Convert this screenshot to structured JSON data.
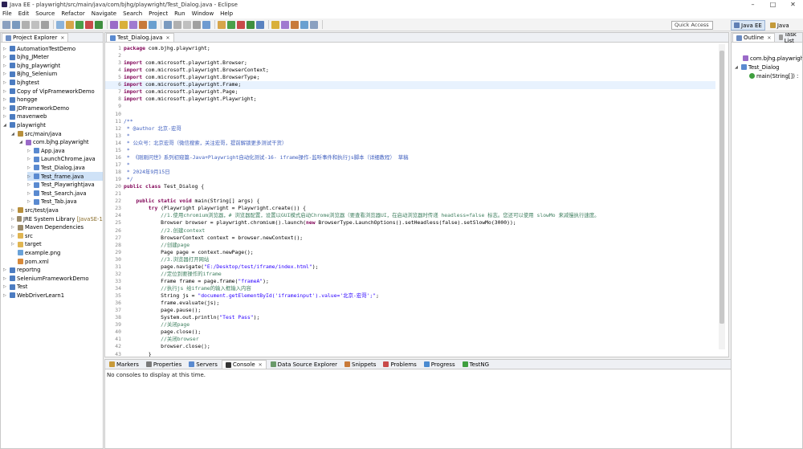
{
  "window": {
    "title": "Java EE - playwright/src/main/java/com/bjhg/playwright/Test_Dialog.java - Eclipse"
  },
  "menu": [
    "File",
    "Edit",
    "Source",
    "Refactor",
    "Navigate",
    "Search",
    "Project",
    "Run",
    "Window",
    "Help"
  ],
  "quick_access": {
    "label": "Quick Access"
  },
  "perspectives": [
    "Java EE",
    "Java"
  ],
  "project_explorer": {
    "tab_label": "Project Explorer",
    "items": [
      {
        "label": "AutomationTestDemo",
        "level": 0,
        "icon": "project",
        "twisty": "closed"
      },
      {
        "label": "bjhg_JMeter",
        "level": 0,
        "icon": "project",
        "twisty": "closed"
      },
      {
        "label": "bjhg_playwright",
        "level": 0,
        "icon": "project",
        "twisty": "closed"
      },
      {
        "label": "Bjhg_Selenium",
        "level": 0,
        "icon": "project",
        "twisty": "closed"
      },
      {
        "label": "bjhgtest",
        "level": 0,
        "icon": "project",
        "twisty": "closed"
      },
      {
        "label": "Copy of VipFrameworkDemo",
        "level": 0,
        "icon": "project",
        "twisty": "closed"
      },
      {
        "label": "hongge",
        "level": 0,
        "icon": "project",
        "twisty": "closed"
      },
      {
        "label": "JDFrameworkDemo",
        "level": 0,
        "icon": "project",
        "twisty": "closed"
      },
      {
        "label": "mavenweb",
        "level": 0,
        "icon": "project",
        "twisty": "closed"
      },
      {
        "label": "playwright",
        "level": 0,
        "icon": "project",
        "twisty": "open"
      },
      {
        "label": "src/main/java",
        "level": 1,
        "icon": "src",
        "twisty": "open"
      },
      {
        "label": "com.bjhg.playwright",
        "level": 2,
        "icon": "pkg",
        "twisty": "open"
      },
      {
        "label": "App.java",
        "level": 3,
        "icon": "java",
        "twisty": "closed"
      },
      {
        "label": "LaunchChrome.java",
        "level": 3,
        "icon": "java",
        "twisty": "closed"
      },
      {
        "label": "Test_Dialog.java",
        "level": 3,
        "icon": "java",
        "twisty": "closed"
      },
      {
        "label": "Test_frame.java",
        "level": 3,
        "icon": "java",
        "twisty": "closed",
        "selected": true
      },
      {
        "label": "Test_Playwrightjava",
        "level": 3,
        "icon": "java",
        "twisty": "closed"
      },
      {
        "label": "Test_Search.java",
        "level": 3,
        "icon": "java",
        "twisty": "closed"
      },
      {
        "label": "Test_Tab.java",
        "level": 3,
        "icon": "java",
        "twisty": "closed"
      },
      {
        "label": "src/test/java",
        "level": 1,
        "icon": "src",
        "twisty": "closed"
      },
      {
        "label": "JRE System Library",
        "suffix": "[JavaSE-1.",
        "level": 1,
        "icon": "lib",
        "twisty": "closed"
      },
      {
        "label": "Maven Dependencies",
        "level": 1,
        "icon": "lib",
        "twisty": "closed"
      },
      {
        "label": "src",
        "level": 1,
        "icon": "folder",
        "twisty": "closed"
      },
      {
        "label": "target",
        "level": 1,
        "icon": "folder",
        "twisty": "closed"
      },
      {
        "label": "example.png",
        "level": 1,
        "icon": "img",
        "twisty": "none"
      },
      {
        "label": "pom.xml",
        "level": 1,
        "icon": "xml",
        "twisty": "none"
      },
      {
        "label": "reportng",
        "level": 0,
        "icon": "project",
        "twisty": "closed"
      },
      {
        "label": "SeleniumFrameworkDemo",
        "level": 0,
        "icon": "project",
        "twisty": "closed"
      },
      {
        "label": "Test",
        "level": 0,
        "icon": "project",
        "twisty": "closed"
      },
      {
        "label": "WebDriverLearn1",
        "level": 0,
        "icon": "project",
        "twisty": "closed"
      }
    ]
  },
  "editor": {
    "tab_label": "Test_Dialog.java",
    "lines": [
      {
        "n": "1",
        "text": "package com.bjhg.playwright;"
      },
      {
        "n": "2",
        "text": ""
      },
      {
        "n": "3",
        "text": "import com.microsoft.playwright.Browser;"
      },
      {
        "n": "4",
        "text": "import com.microsoft.playwright.BrowserContext;"
      },
      {
        "n": "5",
        "text": "import com.microsoft.playwright.BrowserType;"
      },
      {
        "n": "6",
        "text": "import com.microsoft.playwright.Frame;",
        "highlight": true
      },
      {
        "n": "7",
        "text": "import com.microsoft.playwright.Page;"
      },
      {
        "n": "8",
        "text": "import com.microsoft.playwright.Playwright;"
      },
      {
        "n": "9",
        "text": ""
      },
      {
        "n": "10",
        "text": ""
      },
      {
        "n": "11",
        "text": "/**"
      },
      {
        "n": "12",
        "text": " * @author 北京-宏哥"
      },
      {
        "n": "13",
        "text": " *"
      },
      {
        "n": "14",
        "text": " * 公众号：北京宏哥（微信搜索，关注宏哥，提前解锁更多测试干货）"
      },
      {
        "n": "15",
        "text": " *"
      },
      {
        "n": "16",
        "text": " * 《刚刚问世》系列初窥篇-Java+Playwright自动化测试-16- iframe操作-监听事件和执行js脚本（详细教程） 草稿"
      },
      {
        "n": "17",
        "text": " *"
      },
      {
        "n": "18",
        "text": " * 2024年9月15日"
      },
      {
        "n": "19",
        "text": " */"
      },
      {
        "n": "20",
        "text": "public class Test_Dialog {"
      },
      {
        "n": "21",
        "text": ""
      },
      {
        "n": "22",
        "text": "    public static void main(String[] args) {"
      },
      {
        "n": "23",
        "text": "        try (Playwright playwright = Playwright.create()) {"
      },
      {
        "n": "24",
        "text": "            //1.使用chromium浏览器，# 浏览器配置，设置以GUI模式启动Chrome浏览器（要查看浏览器UI，在启动浏览器时传递 headless=false 标志。您还可以使用 slowMo 来减慢执行速度。"
      },
      {
        "n": "25",
        "text": "            Browser browser = playwright.chromium().launch(new BrowserType.LaunchOptions().setHeadless(false).setSlowMo(3000));"
      },
      {
        "n": "26",
        "text": "            //2.创建context"
      },
      {
        "n": "27",
        "text": "            BrowserContext context = browser.newContext();"
      },
      {
        "n": "28",
        "text": "            //创建page"
      },
      {
        "n": "29",
        "text": "            Page page = context.newPage();"
      },
      {
        "n": "30",
        "text": "            //3.浏览器打开网站"
      },
      {
        "n": "31",
        "text": "            page.navigate(\"E:/Desktop/test/iframe/index.html\");"
      },
      {
        "n": "32",
        "text": "            //定位到要操作的iframe"
      },
      {
        "n": "33",
        "text": "            Frame frame = page.frame(\"frameA\");"
      },
      {
        "n": "34",
        "text": "            //执行js 给iframe的输入框输入内容"
      },
      {
        "n": "35",
        "text": "            String js = \"document.getElementById('iframeinput').value='北京-宏哥';\";"
      },
      {
        "n": "36",
        "text": "            frame.evaluate(js);"
      },
      {
        "n": "37",
        "text": "            page.pause();"
      },
      {
        "n": "38",
        "text": "            System.out.println(\"Test Pass\");"
      },
      {
        "n": "39",
        "text": "            //关闭page"
      },
      {
        "n": "40",
        "text": "            page.close();"
      },
      {
        "n": "41",
        "text": "            //关闭browser"
      },
      {
        "n": "42",
        "text": "            browser.close();"
      },
      {
        "n": "43",
        "text": "        }"
      }
    ]
  },
  "bottom_tabs": [
    "Markers",
    "Properties",
    "Servers",
    "Console",
    "Data Source Explorer",
    "Snippets",
    "Problems",
    "Progress",
    "TestNG"
  ],
  "console": {
    "message": "No consoles to display at this time."
  },
  "outline": {
    "tabs": [
      "Outline",
      "Task List"
    ],
    "items": [
      {
        "label": "com.bjhg.playwrigh",
        "level": 1
      },
      {
        "label": "Test_Dialog",
        "level": 0
      },
      {
        "label": "main(String[]) :",
        "level": 2
      }
    ]
  },
  "colors": {
    "keyword": "#7f0055",
    "comment": "#3f7f5f",
    "javadoc": "#3f5fbf",
    "string": "#2a00ff",
    "selection": "#cfe2f7"
  }
}
